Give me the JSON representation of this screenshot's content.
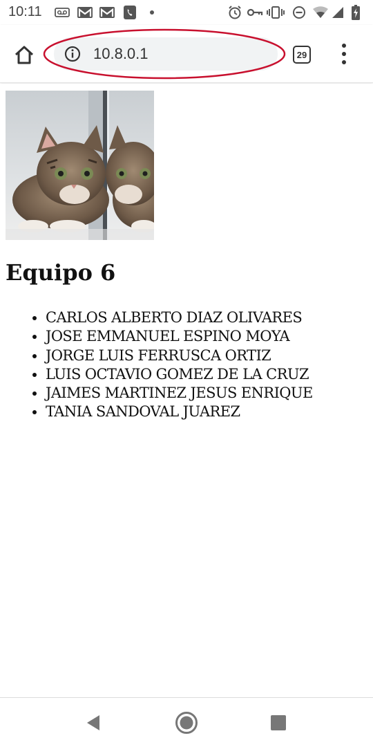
{
  "status_bar": {
    "time": "10:11",
    "icons": [
      "voicemail-icon",
      "gmail-icon",
      "gmail-icon",
      "phone-icon",
      "dot-icon",
      "alarm-icon",
      "vpn-key-icon",
      "vibrate-icon",
      "do-not-disturb-icon",
      "wifi-icon",
      "signal-icon",
      "battery-charging-icon"
    ]
  },
  "browser": {
    "url": "10.8.0.1",
    "tab_count": "29",
    "highlight_color": "#c8102e"
  },
  "page": {
    "heading": "Equipo 6",
    "members": [
      "CARLOS ALBERTO DIAZ OLIVARES",
      "JOSE EMMANUEL ESPINO MOYA",
      "JORGE LUIS FERRUSCA ORTIZ",
      "LUIS OCTAVIO GOMEZ DE LA CRUZ",
      "JAIMES MARTINEZ JESUS ENRIQUE",
      "TANIA SANDOVAL JUAREZ"
    ]
  },
  "nav_bar": {
    "buttons": [
      "back-icon",
      "home-circle-icon",
      "recents-icon"
    ]
  }
}
